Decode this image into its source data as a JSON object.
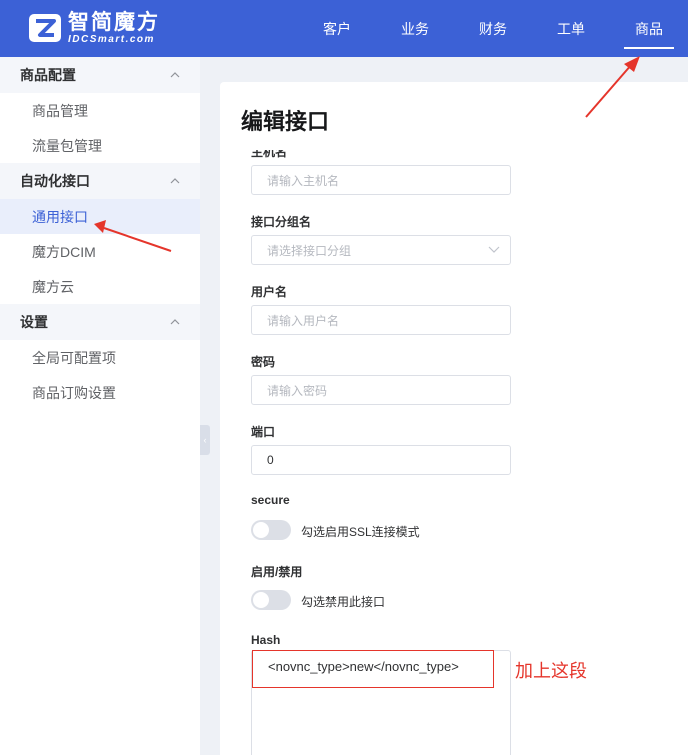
{
  "brand": {
    "name_cn": "智简魔方",
    "name_en": "IDCSmart.com",
    "color": "#3c61d6"
  },
  "nav": [
    {
      "label": "客户"
    },
    {
      "label": "业务"
    },
    {
      "label": "财务"
    },
    {
      "label": "工单"
    },
    {
      "label": "商品",
      "active": true
    }
  ],
  "sidebar": {
    "groups": [
      {
        "title": "商品配置",
        "items": [
          {
            "label": "商品管理"
          },
          {
            "label": "流量包管理"
          }
        ]
      },
      {
        "title": "自动化接口",
        "items": [
          {
            "label": "通用接口",
            "active": true
          },
          {
            "label": "魔方DCIM"
          },
          {
            "label": "魔方云"
          }
        ]
      },
      {
        "title": "设置",
        "items": [
          {
            "label": "全局可配置项"
          },
          {
            "label": "商品订购设置"
          }
        ]
      }
    ]
  },
  "form": {
    "title": "编辑接口",
    "hostname": {
      "label": "主机名",
      "placeholder": "请输入主机名"
    },
    "group": {
      "label": "接口分组名",
      "placeholder": "请选择接口分组"
    },
    "username": {
      "label": "用户名",
      "placeholder": "请输入用户名"
    },
    "password": {
      "label": "密码",
      "placeholder": "请输入密码"
    },
    "port": {
      "label": "端口",
      "value": "0"
    },
    "secure": {
      "label": "secure",
      "text": "勾选启用SSL连接模式",
      "on": false
    },
    "enable": {
      "label": "启用/禁用",
      "text": "勾选禁用此接口",
      "on": false
    },
    "hash": {
      "label": "Hash",
      "value": "<novnc_type>new</novnc_type>"
    }
  },
  "annotation": {
    "note": "加上这段",
    "color": "#e5352b"
  }
}
